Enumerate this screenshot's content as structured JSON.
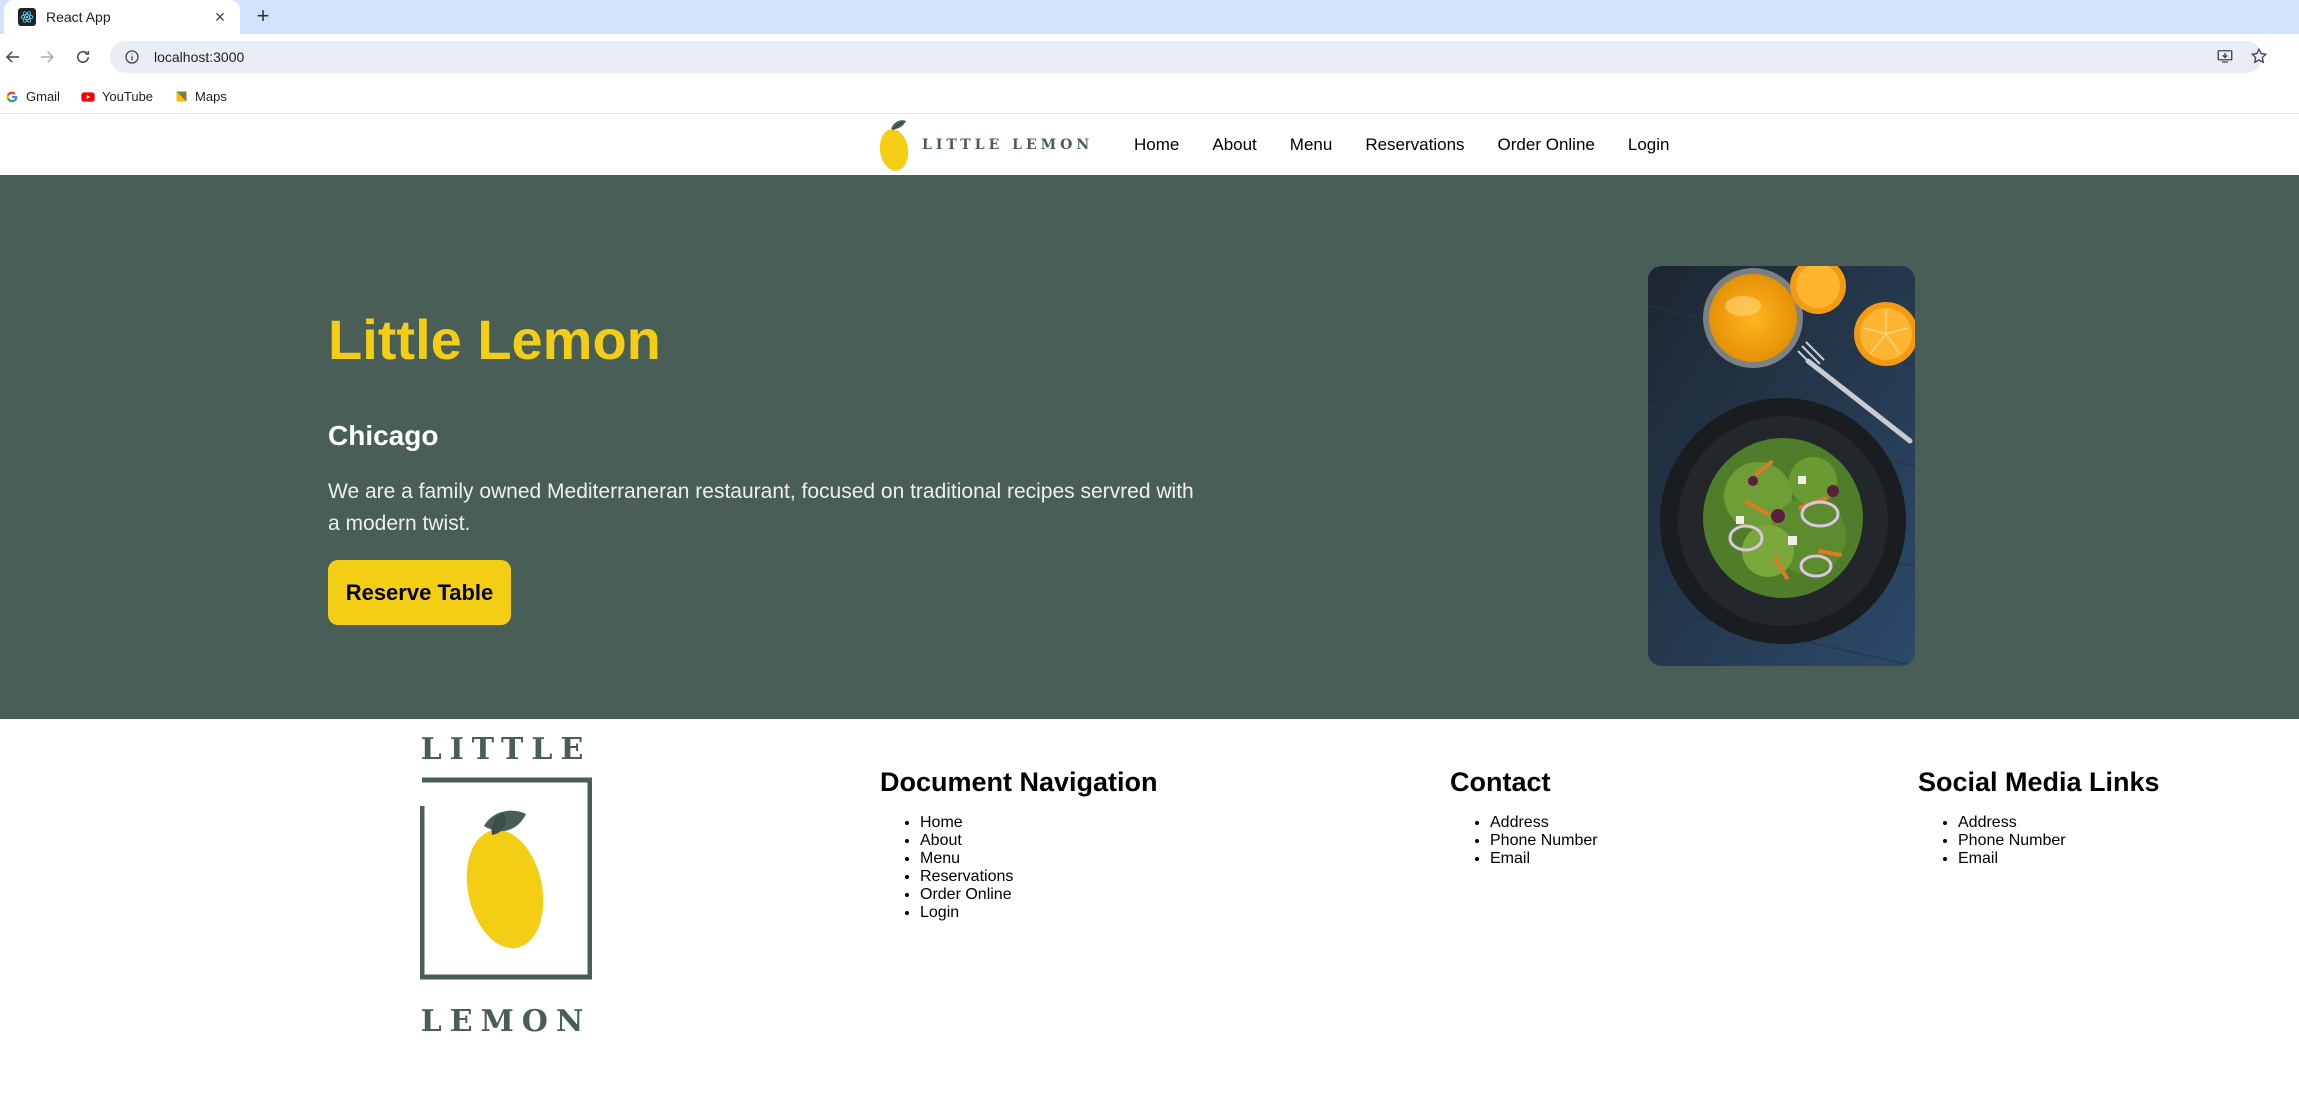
{
  "browser": {
    "tab_title": "React App",
    "tab_close": "×",
    "new_tab": "+",
    "url": "localhost:3000",
    "bookmarks": [
      {
        "label": "Gmail",
        "icon": "google-icon"
      },
      {
        "label": "YouTube",
        "icon": "youtube-icon"
      },
      {
        "label": "Maps",
        "icon": "maps-icon"
      }
    ]
  },
  "site": {
    "logo_text": "LITTLE LEMON",
    "nav": [
      "Home",
      "About",
      "Menu",
      "Reservations",
      "Order Online",
      "Login"
    ]
  },
  "hero": {
    "title": "Little Lemon",
    "subtitle": "Chicago",
    "description": "We are a family owned Mediterraneran restaurant, focused on traditional recipes servred with a modern twist.",
    "button_label": "Reserve Table"
  },
  "footer": {
    "logo_top": "LITTLE",
    "logo_bottom": "LEMON",
    "doc_nav": {
      "heading": "Document Navigation",
      "items": [
        "Home",
        "About",
        "Menu",
        "Reservations",
        "Order Online",
        "Login"
      ]
    },
    "contact": {
      "heading": "Contact",
      "items": [
        "Address",
        "Phone Number",
        "Email"
      ]
    },
    "social": {
      "heading": "Social Media Links",
      "items": [
        "Address",
        "Phone Number",
        "Email"
      ]
    }
  },
  "colors": {
    "brand_green": "#495e57",
    "brand_yellow": "#f4ce14",
    "browser_tabstrip": "#d3e3fd"
  }
}
